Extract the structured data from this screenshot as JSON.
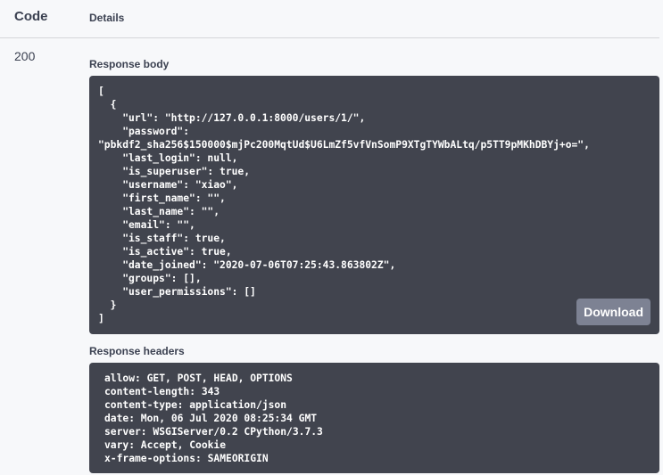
{
  "table": {
    "code_header": "Code",
    "details_header": "Details"
  },
  "response": {
    "status_code": "200",
    "body_label": "Response body",
    "body_lines": [
      "[",
      "  {",
      "    \"url\": \"http://127.0.0.1:8000/users/1/\",",
      "    \"password\":",
      "\"pbkdf2_sha256$150000$mjPc200MqtUd$U6LmZf5vfVnSomP9XTgTYWbALtq/p5TT9pMKhDBYj+o=\",",
      "    \"last_login\": null,",
      "    \"is_superuser\": true,",
      "    \"username\": \"xiao\",",
      "    \"first_name\": \"\",",
      "    \"last_name\": \"\",",
      "    \"email\": \"\",",
      "    \"is_staff\": true,",
      "    \"is_active\": true,",
      "    \"date_joined\": \"2020-07-06T07:25:43.863802Z\",",
      "    \"groups\": [],",
      "    \"user_permissions\": []",
      "  }",
      "]"
    ],
    "download_label": "Download",
    "headers_label": "Response headers",
    "header_lines": [
      "allow: GET, POST, HEAD, OPTIONS",
      "content-length: 343",
      "content-type: application/json",
      "date: Mon, 06 Jul 2020 08:25:34 GMT",
      "server: WSGIServer/0.2 CPython/3.7.3",
      "vary: Accept, Cookie",
      "x-frame-options: SAMEORIGIN"
    ]
  },
  "colors": {
    "background": "#f7f8fa",
    "code_block": "#41444e",
    "button": "#7d8293",
    "text": "#3b4151"
  }
}
